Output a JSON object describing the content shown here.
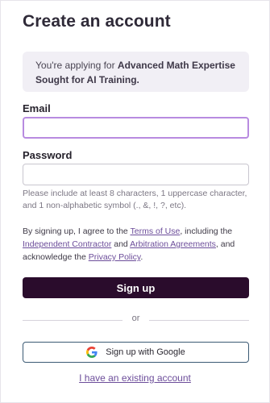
{
  "page": {
    "title": "Create an account"
  },
  "notice": {
    "prefix": "You're applying for ",
    "project": "Advanced Math Expertise Sought for AI Training."
  },
  "form": {
    "email_label": "Email",
    "email_value": "",
    "password_label": "Password",
    "password_value": "",
    "password_hint": "Please include at least 8 characters, 1 uppercase character, and 1 non-alphabetic symbol (., &, !, ?, etc)."
  },
  "terms": {
    "part1": "By signing up, I agree to the ",
    "terms_link": "Terms of Use",
    "part2": ", including the ",
    "contractor_link": "Independent Contractor",
    "part3": " and ",
    "arbitration_link": "Arbitration Agreements",
    "part4": ", and acknowledge the ",
    "privacy_link": "Privacy Policy",
    "part5": "."
  },
  "actions": {
    "signup_label": "Sign up",
    "divider_label": "or",
    "google_label": "Sign up with Google",
    "existing_account_label": "I have an existing account"
  },
  "colors": {
    "primary_button": "#2a0c2c",
    "link": "#6c4d9a",
    "focus_border": "#b88be0",
    "notice_bg": "#f1eff5"
  },
  "icons": {
    "google": "google-icon"
  }
}
